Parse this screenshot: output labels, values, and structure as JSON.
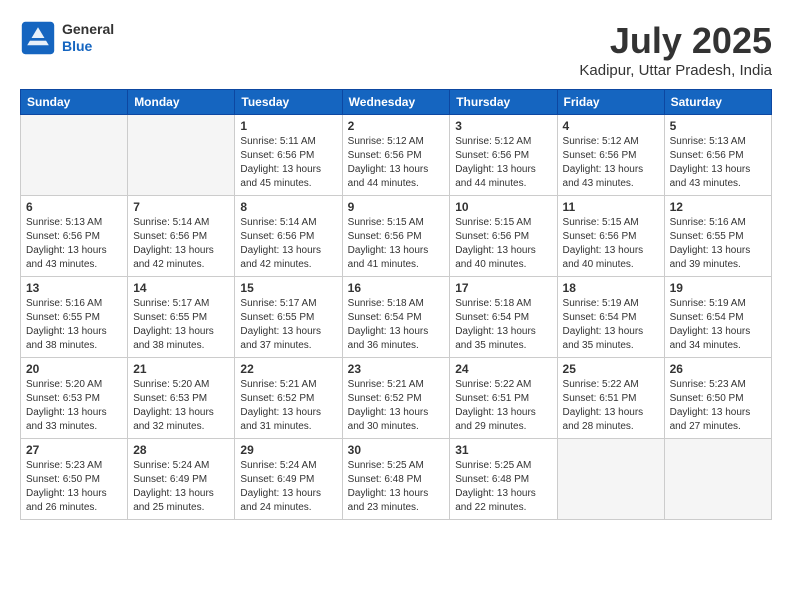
{
  "header": {
    "logo_general": "General",
    "logo_blue": "Blue",
    "month_title": "July 2025",
    "location": "Kadipur, Uttar Pradesh, India"
  },
  "days_of_week": [
    "Sunday",
    "Monday",
    "Tuesday",
    "Wednesday",
    "Thursday",
    "Friday",
    "Saturday"
  ],
  "weeks": [
    [
      {
        "day": "",
        "empty": true
      },
      {
        "day": "",
        "empty": true
      },
      {
        "day": "1",
        "sunrise": "5:11 AM",
        "sunset": "6:56 PM",
        "daylight": "13 hours and 45 minutes."
      },
      {
        "day": "2",
        "sunrise": "5:12 AM",
        "sunset": "6:56 PM",
        "daylight": "13 hours and 44 minutes."
      },
      {
        "day": "3",
        "sunrise": "5:12 AM",
        "sunset": "6:56 PM",
        "daylight": "13 hours and 44 minutes."
      },
      {
        "day": "4",
        "sunrise": "5:12 AM",
        "sunset": "6:56 PM",
        "daylight": "13 hours and 43 minutes."
      },
      {
        "day": "5",
        "sunrise": "5:13 AM",
        "sunset": "6:56 PM",
        "daylight": "13 hours and 43 minutes."
      }
    ],
    [
      {
        "day": "6",
        "sunrise": "5:13 AM",
        "sunset": "6:56 PM",
        "daylight": "13 hours and 43 minutes."
      },
      {
        "day": "7",
        "sunrise": "5:14 AM",
        "sunset": "6:56 PM",
        "daylight": "13 hours and 42 minutes."
      },
      {
        "day": "8",
        "sunrise": "5:14 AM",
        "sunset": "6:56 PM",
        "daylight": "13 hours and 42 minutes."
      },
      {
        "day": "9",
        "sunrise": "5:15 AM",
        "sunset": "6:56 PM",
        "daylight": "13 hours and 41 minutes."
      },
      {
        "day": "10",
        "sunrise": "5:15 AM",
        "sunset": "6:56 PM",
        "daylight": "13 hours and 40 minutes."
      },
      {
        "day": "11",
        "sunrise": "5:15 AM",
        "sunset": "6:56 PM",
        "daylight": "13 hours and 40 minutes."
      },
      {
        "day": "12",
        "sunrise": "5:16 AM",
        "sunset": "6:55 PM",
        "daylight": "13 hours and 39 minutes."
      }
    ],
    [
      {
        "day": "13",
        "sunrise": "5:16 AM",
        "sunset": "6:55 PM",
        "daylight": "13 hours and 38 minutes."
      },
      {
        "day": "14",
        "sunrise": "5:17 AM",
        "sunset": "6:55 PM",
        "daylight": "13 hours and 38 minutes."
      },
      {
        "day": "15",
        "sunrise": "5:17 AM",
        "sunset": "6:55 PM",
        "daylight": "13 hours and 37 minutes."
      },
      {
        "day": "16",
        "sunrise": "5:18 AM",
        "sunset": "6:54 PM",
        "daylight": "13 hours and 36 minutes."
      },
      {
        "day": "17",
        "sunrise": "5:18 AM",
        "sunset": "6:54 PM",
        "daylight": "13 hours and 35 minutes."
      },
      {
        "day": "18",
        "sunrise": "5:19 AM",
        "sunset": "6:54 PM",
        "daylight": "13 hours and 35 minutes."
      },
      {
        "day": "19",
        "sunrise": "5:19 AM",
        "sunset": "6:54 PM",
        "daylight": "13 hours and 34 minutes."
      }
    ],
    [
      {
        "day": "20",
        "sunrise": "5:20 AM",
        "sunset": "6:53 PM",
        "daylight": "13 hours and 33 minutes."
      },
      {
        "day": "21",
        "sunrise": "5:20 AM",
        "sunset": "6:53 PM",
        "daylight": "13 hours and 32 minutes."
      },
      {
        "day": "22",
        "sunrise": "5:21 AM",
        "sunset": "6:52 PM",
        "daylight": "13 hours and 31 minutes."
      },
      {
        "day": "23",
        "sunrise": "5:21 AM",
        "sunset": "6:52 PM",
        "daylight": "13 hours and 30 minutes."
      },
      {
        "day": "24",
        "sunrise": "5:22 AM",
        "sunset": "6:51 PM",
        "daylight": "13 hours and 29 minutes."
      },
      {
        "day": "25",
        "sunrise": "5:22 AM",
        "sunset": "6:51 PM",
        "daylight": "13 hours and 28 minutes."
      },
      {
        "day": "26",
        "sunrise": "5:23 AM",
        "sunset": "6:50 PM",
        "daylight": "13 hours and 27 minutes."
      }
    ],
    [
      {
        "day": "27",
        "sunrise": "5:23 AM",
        "sunset": "6:50 PM",
        "daylight": "13 hours and 26 minutes."
      },
      {
        "day": "28",
        "sunrise": "5:24 AM",
        "sunset": "6:49 PM",
        "daylight": "13 hours and 25 minutes."
      },
      {
        "day": "29",
        "sunrise": "5:24 AM",
        "sunset": "6:49 PM",
        "daylight": "13 hours and 24 minutes."
      },
      {
        "day": "30",
        "sunrise": "5:25 AM",
        "sunset": "6:48 PM",
        "daylight": "13 hours and 23 minutes."
      },
      {
        "day": "31",
        "sunrise": "5:25 AM",
        "sunset": "6:48 PM",
        "daylight": "13 hours and 22 minutes."
      },
      {
        "day": "",
        "empty": true
      },
      {
        "day": "",
        "empty": true
      }
    ]
  ]
}
